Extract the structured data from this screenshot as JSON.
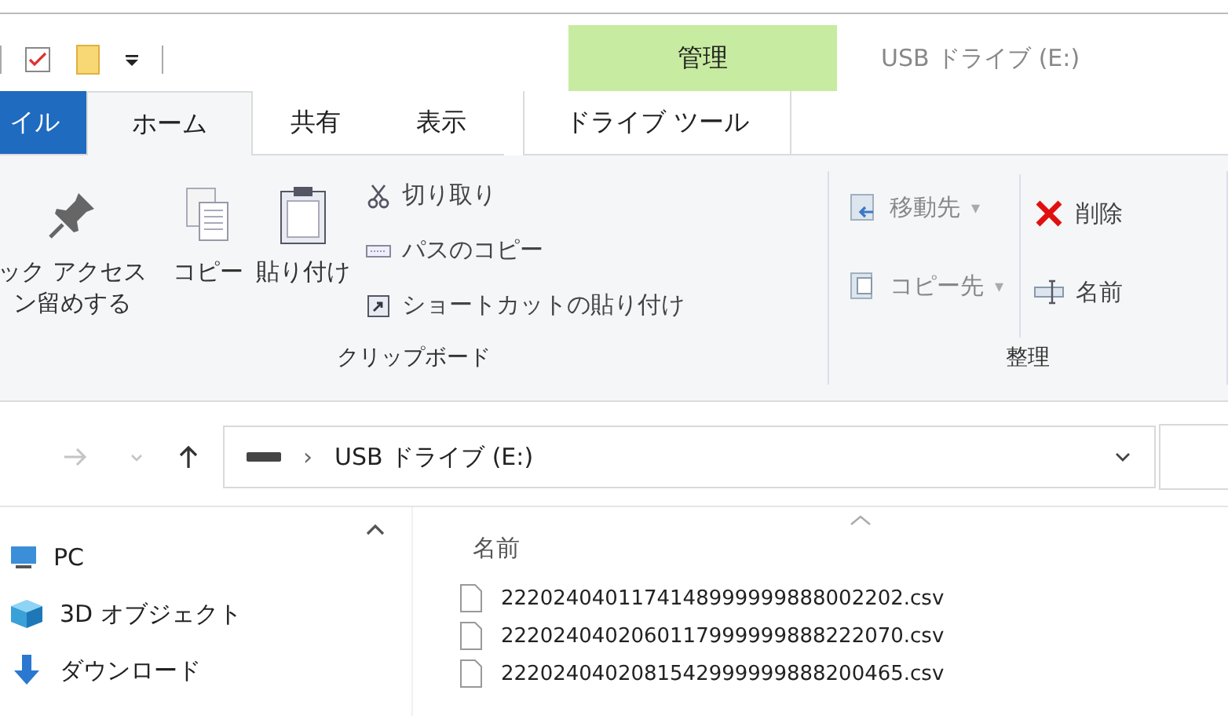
{
  "window": {
    "title": "USB ドライブ (E:)"
  },
  "context_group": {
    "label": "管理"
  },
  "tabs": [
    {
      "label": "イル",
      "kind": "file",
      "selected": false
    },
    {
      "label": "ホーム",
      "kind": "tab",
      "selected": true
    },
    {
      "label": "共有",
      "kind": "tab",
      "selected": false
    },
    {
      "label": "表示",
      "kind": "tab",
      "selected": false
    },
    {
      "label": "ドライブ ツール",
      "kind": "context",
      "selected": false
    }
  ],
  "ribbon": {
    "groups": [
      {
        "label": "クリップボード",
        "large_buttons": [
          {
            "lines": [
              "ック アクセス",
              "ン留めする"
            ],
            "kind": "pin"
          },
          {
            "lines": [
              "コピー"
            ],
            "kind": "copy"
          },
          {
            "lines": [
              "貼り付け"
            ],
            "kind": "paste"
          }
        ],
        "small_buttons": [
          {
            "label": "切り取り",
            "kind": "cut"
          },
          {
            "label": "パスのコピー",
            "kind": "path"
          },
          {
            "label": "ショートカットの貼り付け",
            "kind": "shortcut"
          }
        ]
      },
      {
        "label": "整理",
        "columns": [
          [
            {
              "label": "移動先",
              "kind": "move",
              "caret": "▾",
              "disabled": true
            },
            {
              "label": "コピー先",
              "kind": "copyto",
              "caret": "▾",
              "disabled": true
            }
          ],
          [
            {
              "label": "削除",
              "kind": "delete",
              "disabled": false
            },
            {
              "label": "名前",
              "kind": "rename",
              "disabled": false
            }
          ]
        ]
      }
    ]
  },
  "address_bar": {
    "nav_buttons": [
      {
        "kind": "forward",
        "disabled": true
      },
      {
        "kind": "recent",
        "disabled": true
      },
      {
        "kind": "up",
        "disabled": false
      }
    ],
    "separator": "›",
    "path": "USB ドライブ (E:)"
  },
  "nav_pane": {
    "items": [
      {
        "label": "PC",
        "kind": "pc"
      },
      {
        "label": "3D オブジェクト",
        "kind": "cube"
      },
      {
        "label": "ダウンロード",
        "kind": "download"
      }
    ]
  },
  "file_list": {
    "column": "名前",
    "rows": [
      {
        "name": "2220240401174148999999888002202.csv"
      },
      {
        "name": "2220240402060117999999888222070.csv"
      },
      {
        "name": "2220240402081542999999888200465.csv"
      }
    ]
  }
}
